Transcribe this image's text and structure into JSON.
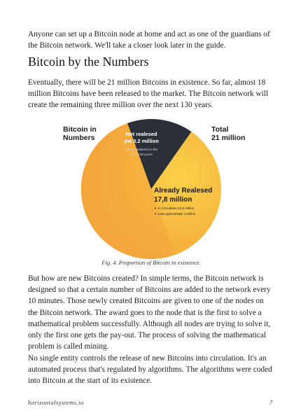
{
  "paragraphs": {
    "intro": "Anyone can set up a Bitcoin node at home and act as one of the guardians of the Bitcoin network. We'll take a closer look later in the guide.",
    "p1": "Eventually, there will be 21 million Bitcoins in existence. So far, almost 18 million Bitcoins have been released to the market. The Bitcoin network will create the remaining three million over the next 130 years.",
    "p2": "But how are new Bitcoins created? In simple terms, the Bitcoin network is designed so that a certain number of Bitcoins are added to the network every 10 minutes. Those newly created Bitcoins are given to one of the nodes on the Bitcoin network. The award goes to the node that is the first to solve a mathematical problem successfully. Although all nodes are trying to solve it, only the first one gets the pay-out. The process of solving the mathematical problem is called mining.",
    "p3": "No single entity controls the release of new Bitcoins into circulation. It's an automated process that's regulated by algorithms. The algorithms were coded into Bitcoin at the start of its existence."
  },
  "heading": "Bitcoin by the Numbers",
  "figure": {
    "caption": "Fig. 4. Proportion of Bitcoin in existence.",
    "label_left_1": "Bitcoin in",
    "label_left_2": "Numbers",
    "label_right_1": "Total",
    "label_right_2": "21 million"
  },
  "chart_data": {
    "type": "pie",
    "title": "",
    "total": 21,
    "unit": "million",
    "slices": [
      {
        "label_1": "Already Realesed",
        "label_2": "17,8 million",
        "value": 17.8,
        "color": "#f7b62e",
        "notes": [
          "In Circulation 13.8 million",
          "Lost approximate 4 million"
        ]
      },
      {
        "label_1": "Not realesed",
        "label_2": "yet 3.2 million",
        "value": 3.2,
        "color": "#2b2f38",
        "notes": [
          "will be realesed in the",
          "next 130 years"
        ]
      }
    ]
  },
  "footer": {
    "site": "horizontalsystems.io",
    "page": "7"
  },
  "colors": {
    "text": "#1c1c1c",
    "pie_orange_light": "#fbd148",
    "pie_orange_dark": "#f3a43a",
    "pie_dark": "#2b2f38"
  }
}
